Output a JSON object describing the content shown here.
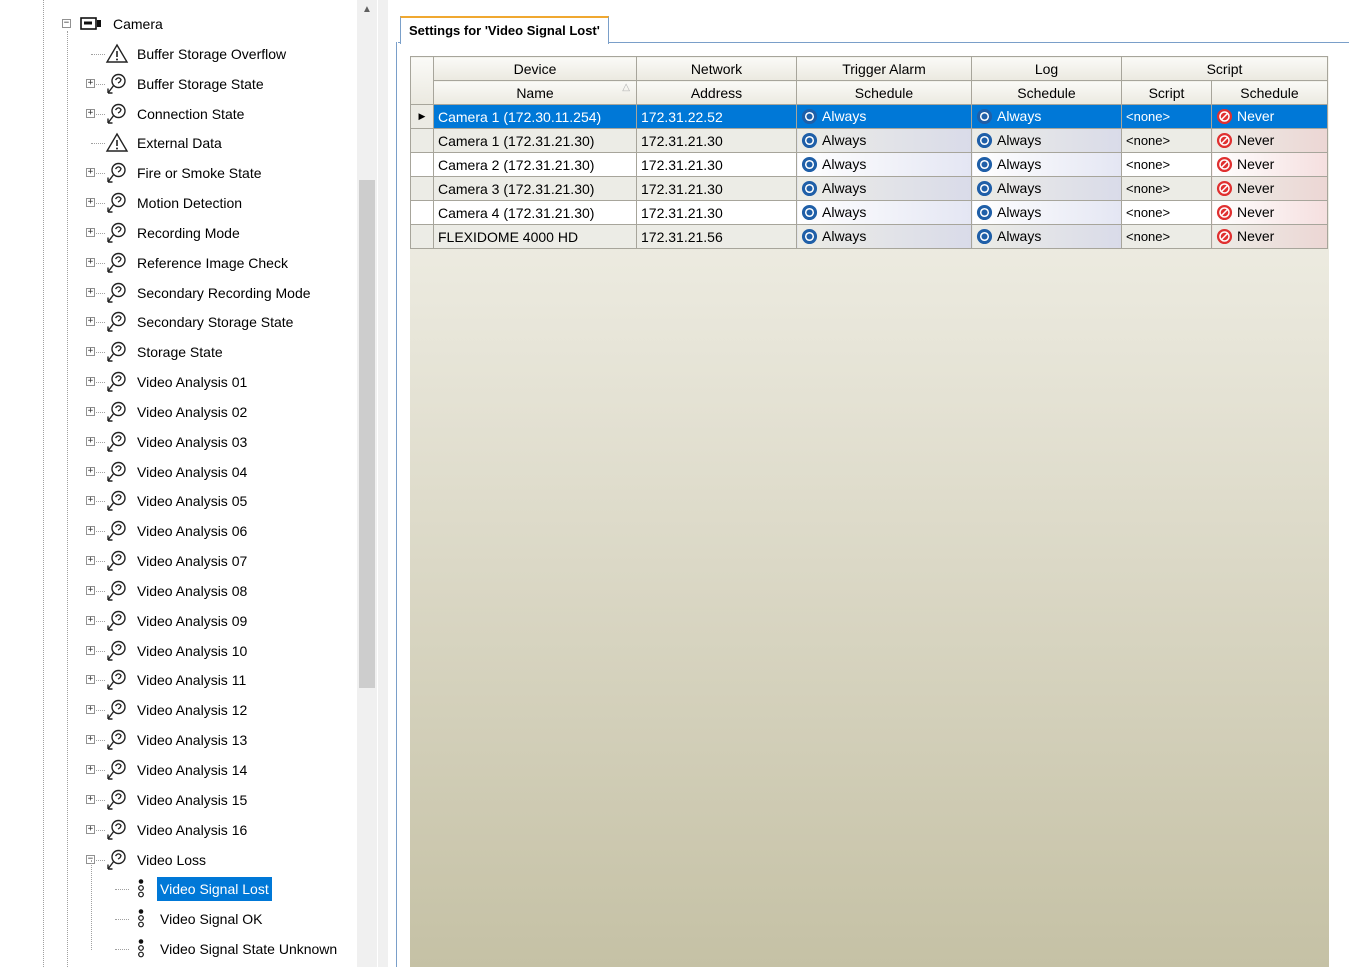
{
  "tree": {
    "root": {
      "label": "Camera",
      "icon": "camera-icon"
    },
    "items": [
      {
        "label": "Buffer Storage Overflow",
        "icon": "warning-icon",
        "expandable": false
      },
      {
        "label": "Buffer Storage State",
        "icon": "link-state-icon",
        "expandable": true
      },
      {
        "label": "Connection State",
        "icon": "link-state-icon",
        "expandable": true
      },
      {
        "label": "External Data",
        "icon": "warning-icon",
        "expandable": false
      },
      {
        "label": "Fire or Smoke State",
        "icon": "link-state-icon",
        "expandable": true
      },
      {
        "label": "Motion Detection",
        "icon": "link-state-icon",
        "expandable": true
      },
      {
        "label": "Recording Mode",
        "icon": "link-state-icon",
        "expandable": true
      },
      {
        "label": "Reference Image Check",
        "icon": "link-state-icon",
        "expandable": true
      },
      {
        "label": "Secondary Recording Mode",
        "icon": "link-state-icon",
        "expandable": true
      },
      {
        "label": "Secondary Storage State",
        "icon": "link-state-icon",
        "expandable": true
      },
      {
        "label": "Storage State",
        "icon": "link-state-icon",
        "expandable": true
      },
      {
        "label": "Video Analysis 01",
        "icon": "link-state-icon",
        "expandable": true
      },
      {
        "label": "Video Analysis 02",
        "icon": "link-state-icon",
        "expandable": true
      },
      {
        "label": "Video Analysis 03",
        "icon": "link-state-icon",
        "expandable": true
      },
      {
        "label": "Video Analysis 04",
        "icon": "link-state-icon",
        "expandable": true
      },
      {
        "label": "Video Analysis 05",
        "icon": "link-state-icon",
        "expandable": true
      },
      {
        "label": "Video Analysis 06",
        "icon": "link-state-icon",
        "expandable": true
      },
      {
        "label": "Video Analysis 07",
        "icon": "link-state-icon",
        "expandable": true
      },
      {
        "label": "Video Analysis 08",
        "icon": "link-state-icon",
        "expandable": true
      },
      {
        "label": "Video Analysis 09",
        "icon": "link-state-icon",
        "expandable": true
      },
      {
        "label": "Video Analysis 10",
        "icon": "link-state-icon",
        "expandable": true
      },
      {
        "label": "Video Analysis 11",
        "icon": "link-state-icon",
        "expandable": true
      },
      {
        "label": "Video Analysis 12",
        "icon": "link-state-icon",
        "expandable": true
      },
      {
        "label": "Video Analysis 13",
        "icon": "link-state-icon",
        "expandable": true
      },
      {
        "label": "Video Analysis 14",
        "icon": "link-state-icon",
        "expandable": true
      },
      {
        "label": "Video Analysis 15",
        "icon": "link-state-icon",
        "expandable": true
      },
      {
        "label": "Video Analysis 16",
        "icon": "link-state-icon",
        "expandable": true
      },
      {
        "label": "Video Loss",
        "icon": "link-state-icon",
        "expandable": true,
        "expanded": true
      }
    ],
    "children": [
      {
        "label": "Video Signal Lost",
        "icon": "event-state-icon",
        "selected": true
      },
      {
        "label": "Video Signal OK",
        "icon": "event-state-icon",
        "selected": false
      },
      {
        "label": "Video Signal State Unknown",
        "icon": "event-state-icon",
        "selected": false
      }
    ]
  },
  "tab": {
    "title": "Settings for 'Video Signal Lost'"
  },
  "grid": {
    "group_headers": [
      "Device",
      "Network",
      "Trigger Alarm",
      "Log",
      "Script"
    ],
    "column_headers": [
      "Name",
      "Address",
      "Schedule",
      "Schedule",
      "Script",
      "Schedule"
    ],
    "rows": [
      {
        "name": "Camera 1 (172.30.11.254)",
        "address": "172.31.22.52",
        "alarm": "Always",
        "log": "Always",
        "script": "<none>",
        "script_schedule": "Never",
        "selected": true
      },
      {
        "name": "Camera 1 (172.31.21.30)",
        "address": "172.31.21.30",
        "alarm": "Always",
        "log": "Always",
        "script": "<none>",
        "script_schedule": "Never"
      },
      {
        "name": "Camera 2 (172.31.21.30)",
        "address": "172.31.21.30",
        "alarm": "Always",
        "log": "Always",
        "script": "<none>",
        "script_schedule": "Never"
      },
      {
        "name": "Camera 3 (172.31.21.30)",
        "address": "172.31.21.30",
        "alarm": "Always",
        "log": "Always",
        "script": "<none>",
        "script_schedule": "Never"
      },
      {
        "name": "Camera 4 (172.31.21.30)",
        "address": "172.31.21.30",
        "alarm": "Always",
        "log": "Always",
        "script": "<none>",
        "script_schedule": "Never"
      },
      {
        "name": "FLEXIDOME 4000 HD",
        "address": "172.31.21.56",
        "alarm": "Always",
        "log": "Always",
        "script": "<none>",
        "script_schedule": "Never"
      }
    ]
  },
  "colors": {
    "selection": "#0078d7",
    "always_icon": "#1f5fa8",
    "never_icon": "#e03030"
  }
}
